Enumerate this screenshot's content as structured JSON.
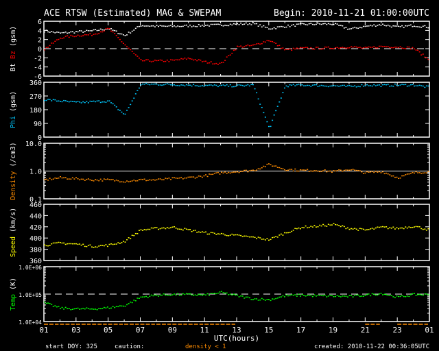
{
  "chart_data": {
    "type": "scatter",
    "title": "ACE RTSW (Estimated) MAG & SWEPAM",
    "begin": "Begin: 2010-11-21 01:00:00UTC",
    "xlabel": "UTC(hours)",
    "x_ticks": [
      "01",
      "03",
      "05",
      "07",
      "09",
      "11",
      "13",
      "15",
      "17",
      "19",
      "21",
      "23",
      "01"
    ],
    "x_hours": [
      0,
      1,
      2,
      3,
      4,
      5,
      6,
      7,
      8,
      9,
      10,
      11,
      12,
      13,
      14,
      15,
      16,
      17,
      18,
      19,
      20,
      21,
      22,
      23,
      24
    ],
    "footer": {
      "start_doy": "start DOY: 325",
      "caution": "caution:",
      "caution_note": "density < 1",
      "created": "created: 2010-11-22 00:36:05UTC"
    },
    "colors": {
      "bt": "#ffffff",
      "bz": "#ff0000",
      "phi": "#00c8ff",
      "density": "#ff8c00",
      "speed": "#ffff00",
      "temp": "#00ff00"
    },
    "panels": [
      {
        "id": "mag",
        "ylabel_parts": [
          "Bt",
          "Bz",
          "(gsm)"
        ],
        "ylim": [
          -6,
          6
        ],
        "scale": "linear",
        "ticks": [
          "6",
          "4",
          "2",
          "0",
          "-2",
          "-4",
          "-6"
        ],
        "tick_values": [
          6,
          4,
          2,
          0,
          -2,
          -4,
          -6
        ],
        "ref_line": 0,
        "ref_style": "dashed",
        "series": [
          {
            "name": "Bt",
            "color": "#ffffff",
            "values": [
              4,
              3.5,
              3.8,
              4,
              4.5,
              3,
              5.2,
              5,
              5,
              5.1,
              5.2,
              5.3,
              5.5,
              5.6,
              4.5,
              5,
              5.4,
              5.5,
              5.5,
              4.4,
              5,
              5.4,
              4.8,
              5.2,
              4.8
            ]
          },
          {
            "name": "Bz",
            "color": "#ff0000",
            "values": [
              0,
              2.5,
              3,
              3.2,
              4.5,
              1,
              -2.5,
              -2.6,
              -2.5,
              -2,
              -2.8,
              -3.2,
              0.5,
              0.8,
              2,
              -0.2,
              0.2,
              0.2,
              0.3,
              0.5,
              0.2,
              0.6,
              0.5,
              0.2,
              -2.5
            ]
          }
        ]
      },
      {
        "id": "phi",
        "ylabel_parts": [
          "Phi",
          "(gsm)"
        ],
        "ylim": [
          0,
          360
        ],
        "scale": "linear",
        "ticks": [
          "360",
          "270",
          "180",
          "90",
          "0"
        ],
        "tick_values": [
          360,
          270,
          180,
          90,
          0
        ],
        "series": [
          {
            "name": "Phi",
            "color": "#00c8ff",
            "values": [
              250,
              240,
              230,
              235,
              240,
              150,
              350,
              350,
              348,
              345,
              342,
              340,
              340,
              345,
              60,
              340,
              345,
              342,
              340,
              335,
              345,
              342,
              345,
              345,
              330
            ]
          }
        ]
      },
      {
        "id": "density",
        "ylabel_parts": [
          "Density",
          "(/cm3)"
        ],
        "ylim": [
          0.1,
          10
        ],
        "scale": "log",
        "ticks": [
          "10.0",
          "1.0",
          "0.1"
        ],
        "tick_values": [
          10,
          1,
          0.1
        ],
        "ref_line": 1,
        "ref_style": "solid",
        "series": [
          {
            "name": "Density",
            "color": "#ff8c00",
            "values": [
              0.5,
              0.6,
              0.55,
              0.5,
              0.5,
              0.45,
              0.5,
              0.5,
              0.55,
              0.6,
              0.7,
              0.9,
              1.0,
              1.1,
              1.8,
              1.2,
              1.1,
              1.1,
              1.0,
              1.2,
              0.9,
              1.0,
              0.6,
              0.9,
              1.0
            ]
          }
        ]
      },
      {
        "id": "speed",
        "ylabel_parts": [
          "Speed",
          "(km/s)"
        ],
        "ylim": [
          360,
          460
        ],
        "scale": "linear",
        "ticks": [
          "460",
          "440",
          "420",
          "400",
          "380",
          "360"
        ],
        "tick_values": [
          460,
          440,
          420,
          400,
          380,
          360
        ],
        "series": [
          {
            "name": "Speed",
            "color": "#ffff00",
            "values": [
              388,
              392,
              390,
              386,
              388,
              395,
              415,
              418,
              420,
              415,
              410,
              408,
              405,
              402,
              398,
              410,
              420,
              422,
              425,
              418,
              415,
              420,
              418,
              422,
              415
            ]
          }
        ]
      },
      {
        "id": "temp",
        "ylabel_parts": [
          "Temp",
          "(K)"
        ],
        "ylim": [
          10000,
          1000000
        ],
        "scale": "log",
        "ticks": [
          "1.0E+06",
          "1.0E+05",
          "1.0E+04"
        ],
        "tick_values": [
          1000000,
          100000,
          10000
        ],
        "ref_line": 100000,
        "ref_style": "dashed",
        "series": [
          {
            "name": "Temp",
            "color": "#00ff00",
            "values": [
              50000,
              32000,
              30000,
              30000,
              33000,
              40000,
              80000,
              95000,
              100000,
              100000,
              95000,
              120000,
              90000,
              70000,
              65000,
              90000,
              95000,
              90000,
              88000,
              85000,
              95000,
              110000,
              80000,
              100000,
              100000
            ]
          }
        ]
      }
    ]
  }
}
